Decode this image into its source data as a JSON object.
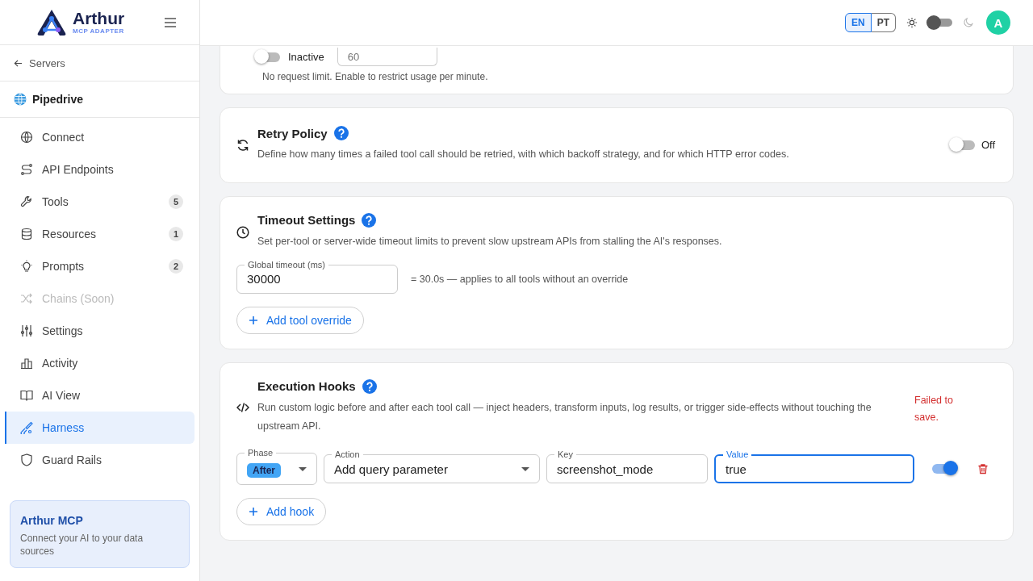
{
  "brand": {
    "name": "Arthur",
    "tagline": "MCP ADAPTER"
  },
  "back_link": "Servers",
  "server": "Pipedrive",
  "nav": [
    {
      "label": "Connect",
      "kind": "globe",
      "selected": false,
      "disabled": false
    },
    {
      "label": "API Endpoints",
      "kind": "route",
      "selected": false,
      "disabled": false
    },
    {
      "label": "Tools",
      "kind": "wrench",
      "badge": "5",
      "selected": false,
      "disabled": false
    },
    {
      "label": "Resources",
      "kind": "database",
      "badge": "1",
      "selected": false,
      "disabled": false
    },
    {
      "label": "Prompts",
      "kind": "bulb",
      "badge": "2",
      "selected": false,
      "disabled": false
    },
    {
      "label": "Chains (Soon)",
      "kind": "shuffle",
      "selected": false,
      "disabled": true
    },
    {
      "label": "Settings",
      "kind": "sliders",
      "selected": false,
      "disabled": false
    },
    {
      "label": "Activity",
      "kind": "bars",
      "selected": false,
      "disabled": false
    },
    {
      "label": "AI View",
      "kind": "book",
      "selected": false,
      "disabled": false
    },
    {
      "label": "Harness",
      "kind": "brush",
      "selected": true,
      "disabled": false
    },
    {
      "label": "Guard Rails",
      "kind": "shield",
      "selected": false,
      "disabled": false
    }
  ],
  "promo": {
    "title": "Arthur MCP",
    "text": "Connect your AI to your data sources"
  },
  "header": {
    "languages": [
      {
        "label": "EN",
        "selected": true
      },
      {
        "label": "PT",
        "selected": false
      }
    ],
    "dark_mode": false,
    "avatar": "A"
  },
  "rate_limit": {
    "on": false,
    "status": "Inactive",
    "value": "60",
    "hint": "No request limit. Enable to restrict usage per minute."
  },
  "retry": {
    "title": "Retry Policy",
    "description": "Define how many times a failed tool call should be retried, with which backoff strategy, and for which HTTP error codes.",
    "on": false,
    "state_label": "Off"
  },
  "timeout": {
    "title": "Timeout Settings",
    "description": "Set per-tool or server-wide timeout limits to prevent slow upstream APIs from stalling the AI's responses.",
    "field_label": "Global timeout (ms)",
    "value": "30000",
    "note": "= 30.0s — applies to all tools without an override",
    "add_button": "Add tool override"
  },
  "hooks": {
    "title": "Execution Hooks",
    "description": "Run custom logic before and after each tool call — inject headers, transform inputs, log results, or trigger side-effects without touching the upstream API.",
    "error": "Failed to save.",
    "rows": [
      {
        "phase_label": "Phase",
        "phase": "After",
        "action_label": "Action",
        "action": "Add query parameter",
        "key_label": "Key",
        "key": "screenshot_mode",
        "value_label": "Value",
        "value": "true",
        "focused": true,
        "enabled": true
      }
    ],
    "add_button": "Add hook"
  }
}
